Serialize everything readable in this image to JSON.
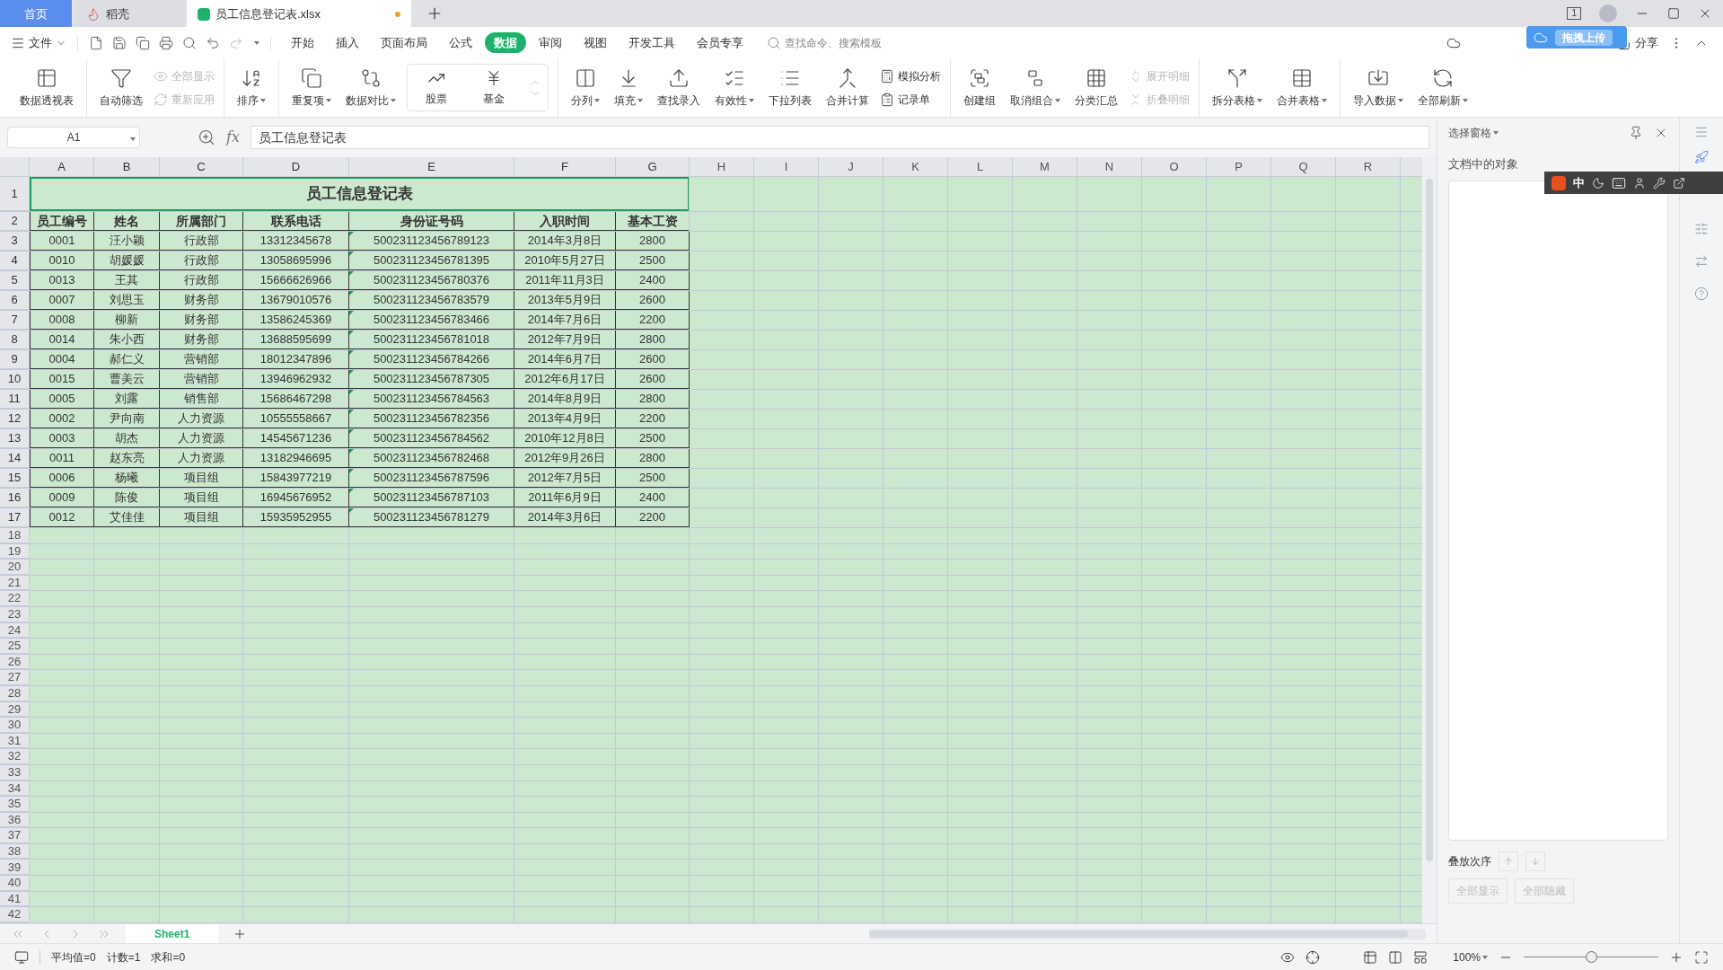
{
  "window": {
    "tabs": [
      {
        "label": "首页",
        "kind": "home",
        "selected": false
      },
      {
        "label": "稻壳",
        "kind": "app",
        "selected": false
      },
      {
        "label": "员工信息登记表.xlsx",
        "kind": "file",
        "selected": true,
        "modified": true
      }
    ],
    "badge": "1"
  },
  "menu": {
    "file": "文件",
    "tabs": [
      {
        "label": "开始",
        "selected": false
      },
      {
        "label": "插入",
        "selected": false
      },
      {
        "label": "页面布局",
        "selected": false
      },
      {
        "label": "公式",
        "selected": false
      },
      {
        "label": "数据",
        "selected": true
      },
      {
        "label": "审阅",
        "selected": false
      },
      {
        "label": "视图",
        "selected": false
      },
      {
        "label": "开发工具",
        "selected": false
      },
      {
        "label": "会员专享",
        "selected": false
      }
    ],
    "search": {
      "placeholder": "查找命令、搜索模板"
    },
    "share": "分享"
  },
  "upload_overlay": {
    "label": "拖拽上传"
  },
  "ribbon": [
    {
      "items": [
        {
          "kind": "large",
          "label": "数据透视表",
          "dropdown": false
        }
      ]
    },
    {
      "items": [
        {
          "kind": "large",
          "label": "自动筛选",
          "dropdown": false
        },
        {
          "kind": "stack",
          "items": [
            {
              "label": "全部显示",
              "disabled": true
            },
            {
              "label": "重新应用",
              "disabled": true
            }
          ]
        }
      ]
    },
    {
      "items": [
        {
          "kind": "large",
          "label": "排序",
          "dropdown": true
        }
      ]
    },
    {
      "items": [
        {
          "kind": "large",
          "label": "重复项",
          "dropdown": true
        },
        {
          "kind": "large",
          "label": "数据对比",
          "dropdown": true
        },
        {
          "kind": "gallery",
          "items": [
            {
              "label": "股票"
            },
            {
              "label": "基金"
            }
          ]
        }
      ]
    },
    {
      "items": [
        {
          "kind": "large",
          "label": "分列",
          "dropdown": true
        },
        {
          "kind": "large",
          "label": "填充",
          "dropdown": true
        },
        {
          "kind": "large",
          "label": "查找录入",
          "dropdown": false
        },
        {
          "kind": "large",
          "label": "有效性",
          "dropdown": true
        },
        {
          "kind": "large",
          "label": "下拉列表",
          "dropdown": false
        },
        {
          "kind": "large",
          "label": "合并计算",
          "dropdown": false
        },
        {
          "kind": "stack",
          "items": [
            {
              "label": "模拟分析",
              "disabled": false
            },
            {
              "label": "记录单",
              "disabled": false
            }
          ]
        }
      ]
    },
    {
      "items": [
        {
          "kind": "large",
          "label": "创建组",
          "dropdown": false
        },
        {
          "kind": "large",
          "label": "取消组合",
          "dropdown": true
        },
        {
          "kind": "large",
          "label": "分类汇总",
          "dropdown": false
        },
        {
          "kind": "stack",
          "items": [
            {
              "label": "展开明细",
              "disabled": true
            },
            {
              "label": "折叠明细",
              "disabled": true
            }
          ]
        }
      ]
    },
    {
      "items": [
        {
          "kind": "large",
          "label": "拆分表格",
          "dropdown": true
        },
        {
          "kind": "large",
          "label": "合并表格",
          "dropdown": true
        }
      ]
    },
    {
      "items": [
        {
          "kind": "large",
          "label": "导入数据",
          "dropdown": true
        },
        {
          "kind": "large",
          "label": "全部刷新",
          "dropdown": true
        }
      ]
    }
  ],
  "formula_bar": {
    "name_box": "A1",
    "fx": "fx",
    "value": "员工信息登记表"
  },
  "sheet": {
    "columns": [
      "A",
      "B",
      "C",
      "D",
      "E",
      "F",
      "G",
      "H",
      "I",
      "J",
      "K",
      "L",
      "M",
      "N",
      "O",
      "P",
      "Q",
      "R"
    ],
    "row_numbers": [
      "1",
      "2",
      "3",
      "4",
      "5",
      "6",
      "7",
      "8",
      "9",
      "10",
      "11",
      "12",
      "13",
      "14",
      "15",
      "16",
      "17",
      "18",
      "19",
      "20",
      "21",
      "22",
      "23",
      "24",
      "25",
      "26",
      "27",
      "28",
      "29",
      "30",
      "31",
      "32",
      "33",
      "34",
      "35",
      "36",
      "37",
      "38",
      "39",
      "40",
      "41",
      "42"
    ],
    "title": "员工信息登记表",
    "header": [
      "员工编号",
      "姓名",
      "所属部门",
      "联系电话",
      "身份证号码",
      "入职时间",
      "基本工资"
    ],
    "rows": [
      {
        "cells": [
          "0001",
          "汪小颖",
          "行政部",
          "13312345678",
          "500231123456789123",
          "2014年3月8日",
          "2800"
        ],
        "flagged": true
      },
      {
        "cells": [
          "0010",
          "胡媛媛",
          "行政部",
          "13058695996",
          "500231123456781395",
          "2010年5月27日",
          "2500"
        ],
        "flagged": true
      },
      {
        "cells": [
          "0013",
          "王其",
          "行政部",
          "15666626966",
          "500231123456780376",
          "2011年11月3日",
          "2400"
        ],
        "flagged": true
      },
      {
        "cells": [
          "0007",
          "刘思玉",
          "财务部",
          "13679010576",
          "500231123456783579",
          "2013年5月9日",
          "2600"
        ],
        "flagged": true
      },
      {
        "cells": [
          "0008",
          "柳新",
          "财务部",
          "13586245369",
          "500231123456783466",
          "2014年7月6日",
          "2200"
        ],
        "flagged": true
      },
      {
        "cells": [
          "0014",
          "朱小西",
          "财务部",
          "13688595699",
          "500231123456781018",
          "2012年7月9日",
          "2800"
        ],
        "flagged": true
      },
      {
        "cells": [
          "0004",
          "郝仁义",
          "营销部",
          "18012347896",
          "500231123456784266",
          "2014年6月7日",
          "2600"
        ],
        "flagged": true
      },
      {
        "cells": [
          "0015",
          "曹美云",
          "营销部",
          "13946962932",
          "500231123456787305",
          "2012年6月17日",
          "2600"
        ],
        "flagged": true
      },
      {
        "cells": [
          "0005",
          "刘露",
          "销售部",
          "15686467298",
          "500231123456784563",
          "2014年8月9日",
          "2800"
        ],
        "flagged": true
      },
      {
        "cells": [
          "0002",
          "尹向南",
          "人力资源",
          "10555558667",
          "500231123456782356",
          "2013年4月9日",
          "2200"
        ],
        "flagged": true
      },
      {
        "cells": [
          "0003",
          "胡杰",
          "人力资源",
          "14545671236",
          "500231123456784562",
          "2010年12月8日",
          "2500"
        ],
        "flagged": true
      },
      {
        "cells": [
          "0011",
          "赵东亮",
          "人力资源",
          "13182946695",
          "500231123456782468",
          "2012年9月26日",
          "2800"
        ],
        "flagged": true
      },
      {
        "cells": [
          "0006",
          "杨曦",
          "项目组",
          "15843977219",
          "500231123456787596",
          "2012年7月5日",
          "2500"
        ],
        "flagged": true
      },
      {
        "cells": [
          "0009",
          "陈俊",
          "项目组",
          "16945676952",
          "500231123456787103",
          "2011年6月9日",
          "2400"
        ],
        "flagged": true
      },
      {
        "cells": [
          "0012",
          "艾佳佳",
          "项目组",
          "15935952955",
          "500231123456781279",
          "2014年3月6日",
          "2200"
        ],
        "flagged": true
      }
    ]
  },
  "sheet_tabs": [
    {
      "label": "Sheet1",
      "selected": true
    }
  ],
  "status_bar": {
    "stats": [
      "平均值=0",
      "计数=1",
      "求和=0"
    ],
    "zoom": "100%",
    "zoom_slider": {
      "level": 0.5
    }
  },
  "selection_pane": {
    "title": "选择窗格",
    "objects_label": "文档中的对象",
    "order_label": "叠放次序",
    "buttons": [
      {
        "label": "全部显示",
        "disabled": true
      },
      {
        "label": "全部隐藏",
        "disabled": true
      }
    ]
  },
  "ime_bar": {
    "mode": "中"
  }
}
